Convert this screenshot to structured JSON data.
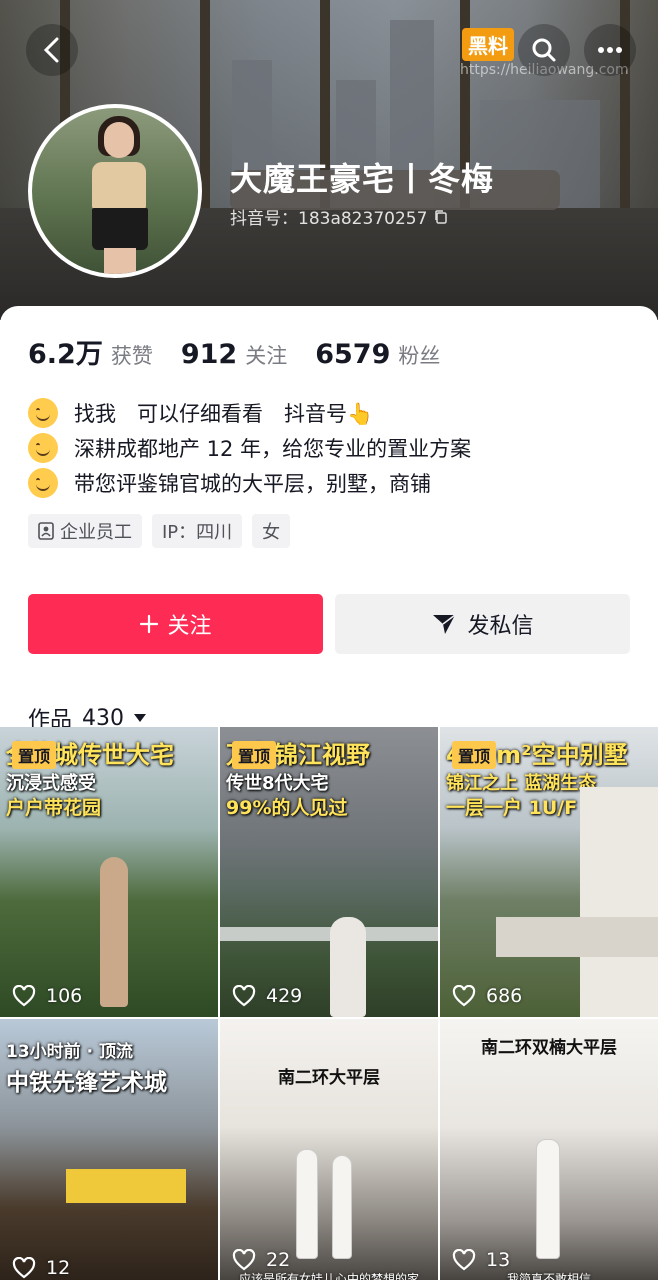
{
  "header": {
    "name": "大魔王豪宅丨冬梅",
    "douyin_id": "抖音号：183a82370257",
    "watermark": "黑料",
    "watermark_url": "https://heiliaowang.com"
  },
  "stats": [
    {
      "value": "6.2万",
      "label": "获赞"
    },
    {
      "value": "912",
      "label": "关注"
    },
    {
      "value": "6579",
      "label": "粉丝"
    }
  ],
  "bio": [
    "找我　可以仔细看看　抖音号👆",
    "深耕成都地产 12 年，给您专业的置业方案",
    "带您评鉴锦官城的大平层，别墅，商铺"
  ],
  "tags": [
    "企业员工",
    "IP：四川",
    "女"
  ],
  "actions": {
    "follow": "关注",
    "message": "发私信"
  },
  "works": {
    "label": "作品",
    "count": "430"
  },
  "videos": [
    {
      "pinned": "置顶",
      "line1": "全能城传世大宅",
      "line2": "沉浸式感受",
      "line3": "户户带花园",
      "likes": "106"
    },
    {
      "pinned": "置顶",
      "line1": "万象锦江视野",
      "line2": "传世8代大宅",
      "line3": "99%的人见过",
      "likes": "429"
    },
    {
      "pinned": "置顶",
      "line1": "460m²空中别墅",
      "line2": "锦江之上 蓝湖生态",
      "line3": "一层一户 1U/F",
      "likes": "686"
    },
    {
      "line1": "13小时前 · 顶流",
      "line2": "中铁先锋艺术城",
      "likes": "12"
    },
    {
      "title": "南二环大平层",
      "caption": "应该是所有女娃儿心中的梦想的家",
      "likes": "22"
    },
    {
      "title": "南二环双楠大平层",
      "caption": "我简直不敢相信",
      "likes": "13"
    }
  ],
  "colors": {
    "accent": "#fe2c55",
    "pin": "#fec84d",
    "overlay_text": "#ffe35a"
  }
}
